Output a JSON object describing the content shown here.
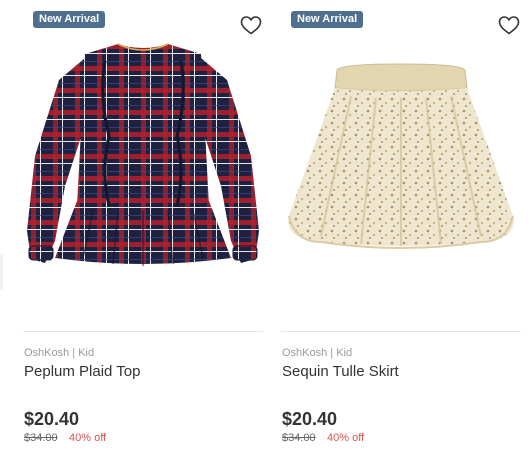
{
  "products": [
    {
      "badge": "New Arrival",
      "brand": "OshKosh | Kid",
      "name": "Peplum Plaid Top",
      "price": "$20.40",
      "original_price": "$34.00",
      "discount": "40% off",
      "image_icon": "plaid-peplum-top-image"
    },
    {
      "badge": "New Arrival",
      "brand": "OshKosh | Kid",
      "name": "Sequin Tulle Skirt",
      "price": "$20.40",
      "original_price": "$34.00",
      "discount": "40% off",
      "image_icon": "sequin-tulle-skirt-image"
    }
  ],
  "colors": {
    "badge_bg": "#4f6f8f",
    "discount": "#d9534f",
    "plaid_navy": "#1e2140",
    "plaid_red": "#b3202a",
    "skirt_gold": "#e8dcc0"
  }
}
